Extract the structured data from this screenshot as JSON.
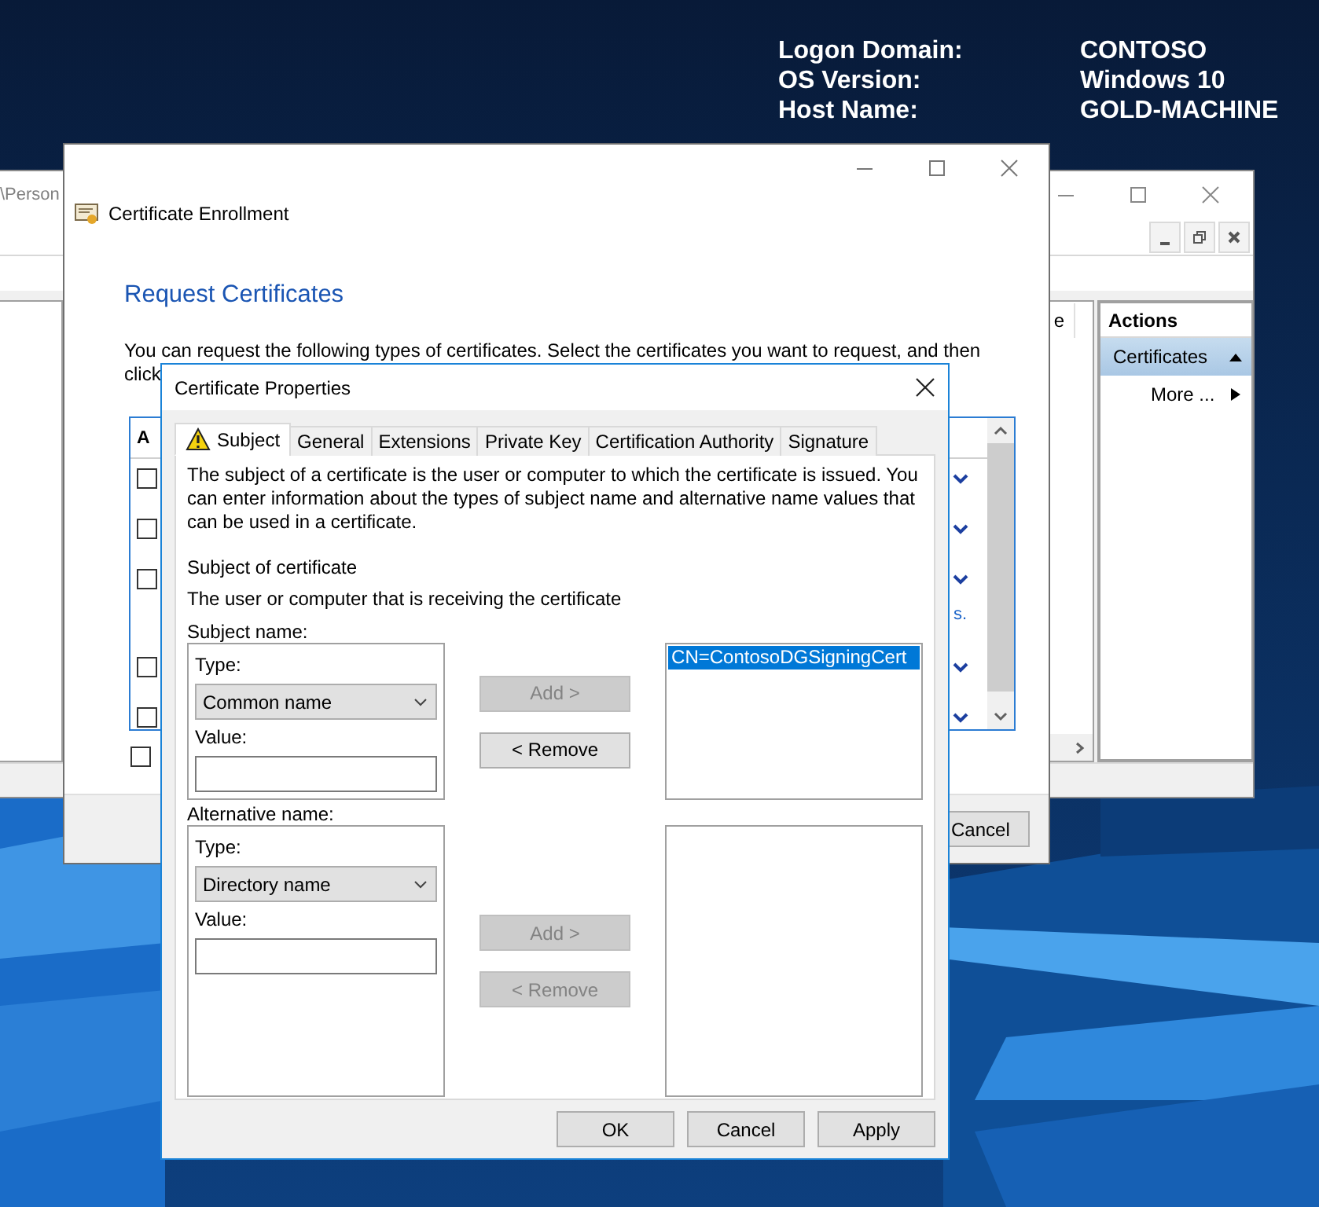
{
  "desktop_info": [
    {
      "label": "Logon Domain:",
      "value": "CONTOSO"
    },
    {
      "label": "OS Version:",
      "value": "Windows 10"
    },
    {
      "label": "Host Name:",
      "value": "GOLD-MACHINE"
    }
  ],
  "mmc_window": {
    "title": "\\Person",
    "column_fragment": "e",
    "actions": {
      "title": "Actions",
      "items": [
        {
          "label": "Certificates",
          "kind": "group",
          "selected": true
        },
        {
          "label": "More ...",
          "kind": "submenu",
          "selected": false
        }
      ]
    }
  },
  "enrollment_window": {
    "title": "Certificate Enrollment",
    "heading": "Request Certificates",
    "intro_lines": [
      "You can request the following types of certificates. Select the certificates you want to request, and then",
      "click"
    ],
    "list_header": "A",
    "list_rows": [
      {
        "checked": false
      },
      {
        "checked": false
      },
      {
        "checked": false,
        "note": "s."
      },
      {
        "checked": false
      },
      {
        "checked": false
      }
    ],
    "show_all": {
      "checked": false
    },
    "buttons": [
      "Cancel"
    ]
  },
  "properties_dialog": {
    "title": "Certificate Properties",
    "tabs": [
      {
        "label": "Subject",
        "selected": true,
        "warning": true
      },
      {
        "label": "General",
        "selected": false,
        "warning": false
      },
      {
        "label": "Extensions",
        "selected": false,
        "warning": false
      },
      {
        "label": "Private Key",
        "selected": false,
        "warning": false
      },
      {
        "label": "Certification Authority",
        "selected": false,
        "warning": false
      },
      {
        "label": "Signature",
        "selected": false,
        "warning": false
      }
    ],
    "description": "The subject of a certificate is the user or computer to which the certificate is issued. You can enter information about the types of subject name and alternative name values that can be used in a certificate.",
    "subject_heading": "Subject of certificate",
    "subject_note": "The user or computer that is receiving the certificate",
    "groups": [
      {
        "title": "Subject name:",
        "type_label": "Type:",
        "type_value": "Common name",
        "value_label": "Value:",
        "add": {
          "label": "Add >",
          "disabled": true
        },
        "remove": {
          "label": "< Remove",
          "disabled": false
        },
        "entries": [
          {
            "text": "CN=ContosoDGSigningCert",
            "selected": true
          }
        ]
      },
      {
        "title": "Alternative name:",
        "type_label": "Type:",
        "type_value": "Directory name",
        "value_label": "Value:",
        "add": {
          "label": "Add >",
          "disabled": true
        },
        "remove": {
          "label": "< Remove",
          "disabled": true
        }
      }
    ],
    "buttons": [
      "OK",
      "Cancel",
      "Apply"
    ]
  }
}
